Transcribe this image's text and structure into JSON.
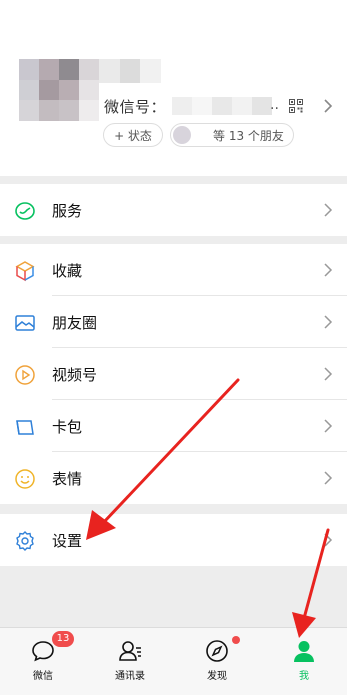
{
  "profile": {
    "wechat_id_label": "微信号：",
    "wechat_id_ellipsis": "..",
    "status_button": "+ 状态",
    "friends_text": "等 13 个朋友"
  },
  "menu": {
    "services": "服务",
    "favorites": "收藏",
    "moments": "朋友圈",
    "channels": "视频号",
    "cards": "卡包",
    "stickers": "表情",
    "settings": "设置"
  },
  "tabs": [
    {
      "label": "微信",
      "icon": "chat-bubble-icon",
      "badge": "13"
    },
    {
      "label": "通讯录",
      "icon": "contacts-icon"
    },
    {
      "label": "发现",
      "icon": "compass-icon"
    },
    {
      "label": "我",
      "icon": "person-icon",
      "active": true
    }
  ],
  "colors": {
    "accent_green": "#07c160",
    "badge_red": "#f04c4c",
    "annotation_arrow": "#e8231f"
  }
}
